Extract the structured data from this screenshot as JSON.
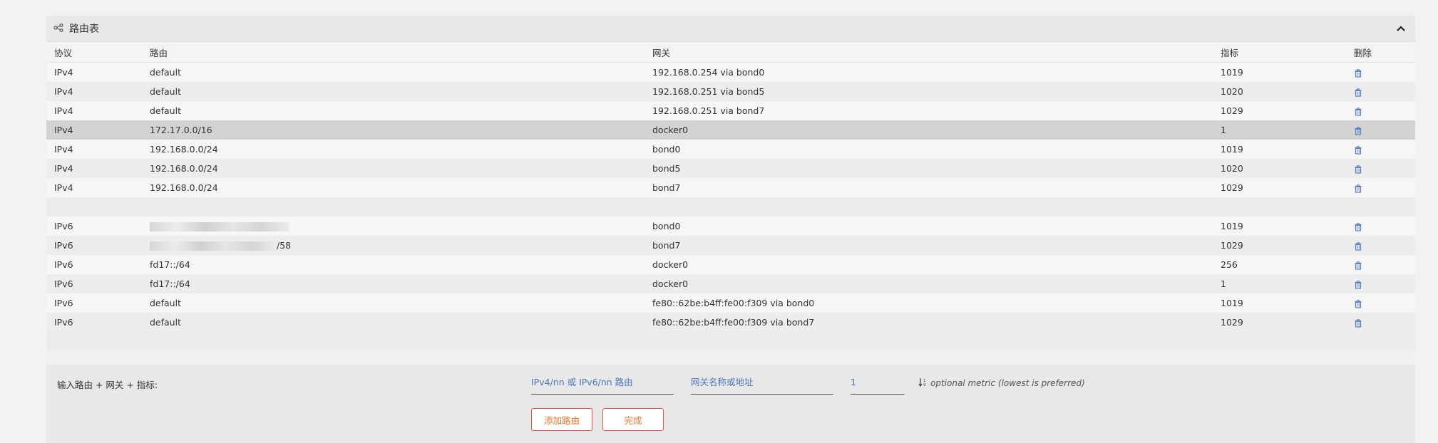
{
  "panel": {
    "title": "路由表"
  },
  "table": {
    "headers": {
      "protocol": "协议",
      "route": "路由",
      "gateway": "网关",
      "metric": "指标",
      "delete": "删除"
    },
    "rows": [
      {
        "protocol": "IPv4",
        "route": "default",
        "gateway": "192.168.0.254 via bond0",
        "metric": "1019"
      },
      {
        "protocol": "IPv4",
        "route": "default",
        "gateway": "192.168.0.251 via bond5",
        "metric": "1020"
      },
      {
        "protocol": "IPv4",
        "route": "default",
        "gateway": "192.168.0.251 via bond7",
        "metric": "1029"
      },
      {
        "protocol": "IPv4",
        "route": "172.17.0.0/16",
        "gateway": "docker0",
        "metric": "1"
      },
      {
        "protocol": "IPv4",
        "route": "192.168.0.0/24",
        "gateway": "bond0",
        "metric": "1019"
      },
      {
        "protocol": "IPv4",
        "route": "192.168.0.0/24",
        "gateway": "bond5",
        "metric": "1020"
      },
      {
        "protocol": "IPv4",
        "route": "192.168.0.0/24",
        "gateway": "bond7",
        "metric": "1029"
      }
    ],
    "rows_v6": [
      {
        "protocol": "IPv6",
        "route": "",
        "gateway": "bond0",
        "metric": "1019"
      },
      {
        "protocol": "IPv6",
        "route": "/58",
        "gateway": "bond7",
        "metric": "1029"
      },
      {
        "protocol": "IPv6",
        "route": "fd17::/64",
        "gateway": "docker0",
        "metric": "256"
      },
      {
        "protocol": "IPv6",
        "route": "fd17::/64",
        "gateway": "docker0",
        "metric": "1"
      },
      {
        "protocol": "IPv6",
        "route": "default",
        "gateway": "fe80::62be:b4ff:fe00:f309 via bond0",
        "metric": "1019"
      },
      {
        "protocol": "IPv6",
        "route": "default",
        "gateway": "fe80::62be:b4ff:fe00:f309 via bond7",
        "metric": "1029"
      }
    ]
  },
  "form": {
    "label": "输入路由 + 网关 + 指标:",
    "route_placeholder": "IPv4/nn 或 IPv6/nn 路由",
    "gateway_placeholder": "网关名称或地址",
    "metric_value": "1",
    "metric_hint": "optional metric (lowest is preferred)",
    "add_label": "添加路由",
    "done_label": "完成"
  },
  "colors": {
    "accent": "#4a78b8",
    "button_border": "#d9534f",
    "button_text": "#e8742a",
    "trash": "#5b7fc0"
  },
  "icons": {
    "title": "share-nodes-icon",
    "collapse": "chevron-up-icon",
    "delete": "trash-icon",
    "sort": "sort-numeric-icon"
  }
}
